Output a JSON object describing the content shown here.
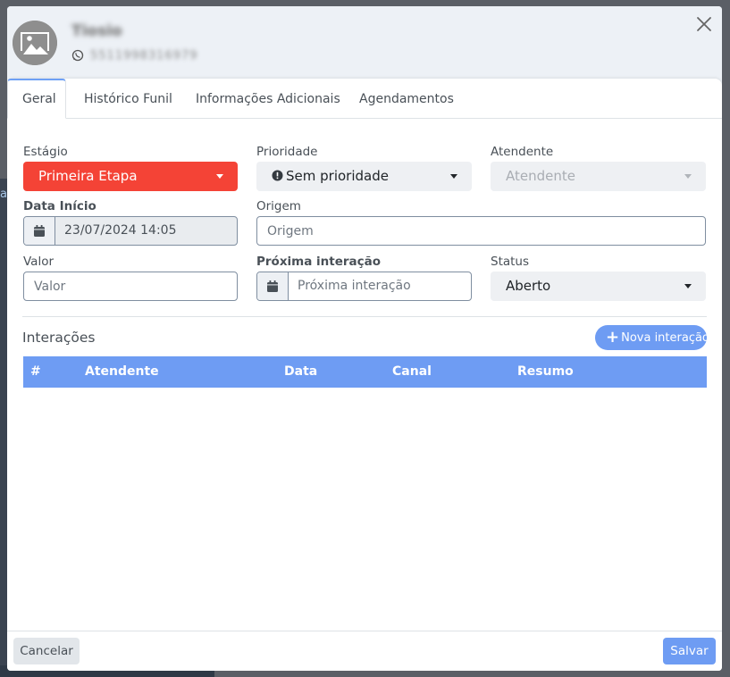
{
  "contact": {
    "name": "Tiosio",
    "phone": "5511998316979"
  },
  "tabs": [
    {
      "label": "Geral"
    },
    {
      "label": "Histórico Funil"
    },
    {
      "label": "Informações Adicionais"
    },
    {
      "label": "Agendamentos"
    }
  ],
  "form": {
    "stage": {
      "label": "Estágio",
      "value": "Primeira Etapa"
    },
    "priority": {
      "label": "Prioridade",
      "value": "Sem prioridade"
    },
    "attendant": {
      "label": "Atendente",
      "placeholder": "Atendente"
    },
    "start_date": {
      "label": "Data Início",
      "value": "23/07/2024 14:05"
    },
    "origin": {
      "label": "Origem",
      "placeholder": "Origem"
    },
    "value": {
      "label": "Valor",
      "placeholder": "Valor"
    },
    "next_interaction": {
      "label": "Próxima interação",
      "placeholder": "Próxima interação"
    },
    "status": {
      "label": "Status",
      "value": "Aberto"
    }
  },
  "interactions": {
    "title": "Interações",
    "add_label": "Nova interação",
    "columns": [
      "#",
      "Atendente",
      "Data",
      "Canal",
      "Resumo"
    ]
  },
  "footer": {
    "cancel_label": "Cancelar",
    "save_label": "Salvar"
  },
  "colors": {
    "accent": "#6e9cf3",
    "stage": "#f44336"
  },
  "backdrop_fragment": "a"
}
